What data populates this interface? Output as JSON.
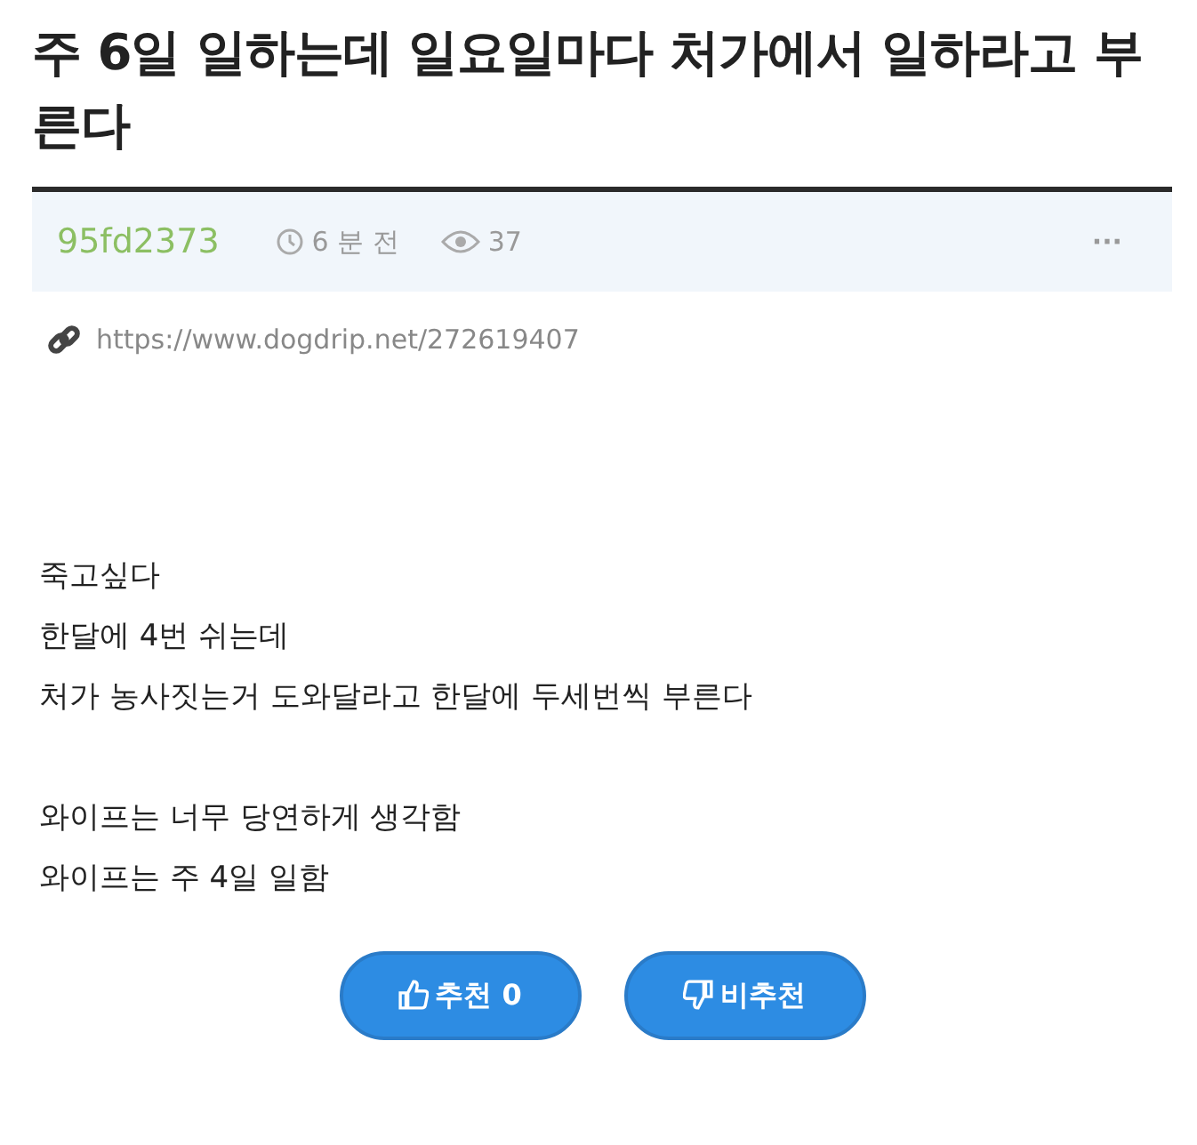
{
  "title": "주 6일 일하는데 일요일마다 처가에서 일하라고 부른다",
  "meta": {
    "author": "95fd2373",
    "time": "6 분 전",
    "views": "37",
    "more": "···"
  },
  "url": "https://www.dogdrip.net/272619407",
  "body": [
    [
      "죽고싶다",
      "한달에 4번 쉬는데",
      "처가 농사짓는거 도와달라고 한달에 두세번씩 부른다"
    ],
    [
      "와이프는 너무 당연하게 생각함",
      "와이프는 주 4일 일함"
    ]
  ],
  "votes": [
    {
      "kind": "up",
      "label": "추천 0"
    },
    {
      "kind": "down",
      "label": "비추천"
    }
  ]
}
